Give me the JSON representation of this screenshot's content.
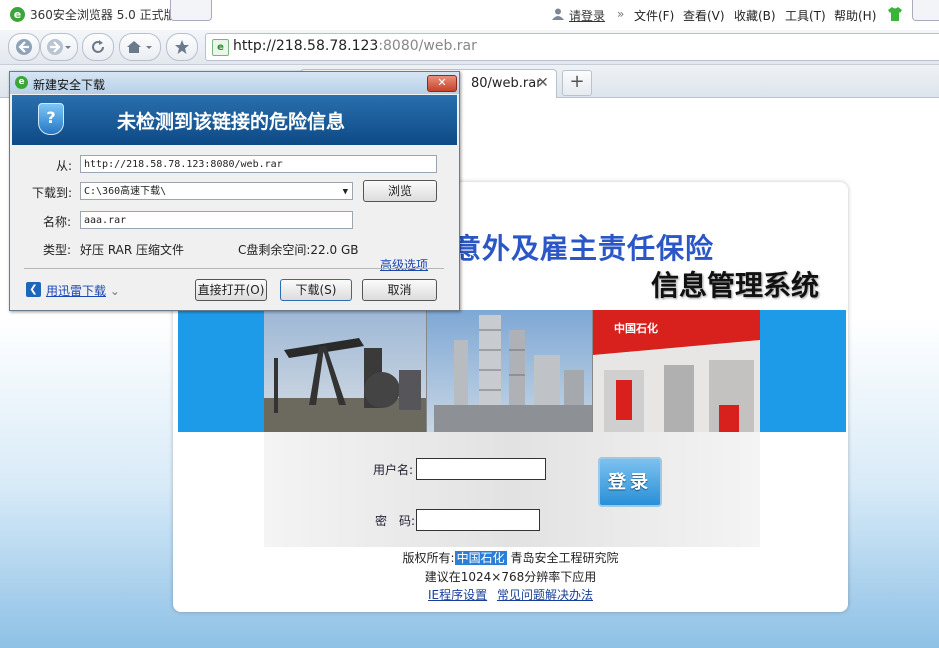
{
  "browser": {
    "title": "360安全浏览器 5.0 正式版",
    "login": "请登录",
    "menu": [
      "文件(F)",
      "查看(V)",
      "收藏(B)",
      "工具(T)",
      "帮助(H)"
    ],
    "url_host": "http://218.58.78.123",
    "url_rest": ":8080/web.rar",
    "tab_label": "80/web.rar"
  },
  "dialog": {
    "title": "新建安全下载",
    "banner": "未检测到该链接的危险信息",
    "from_label": "从:",
    "from_value": "http://218.58.78.123:8080/web.rar",
    "saveto_label": "下载到:",
    "saveto_value": "C:\\360高速下载\\",
    "browse_button": "浏览",
    "name_label": "名称:",
    "name_value": "aaa.rar",
    "type_label": "类型:",
    "type_value": "好压 RAR 压缩文件",
    "disk_space": "C盘剩余空间:22.0 GB",
    "advanced_link": "高级选项",
    "xunlei_link": "用迅雷下载",
    "open_button": "直接打开(O)",
    "download_button": "下载(S)",
    "cancel_button": "取消"
  },
  "site": {
    "title_line1": "意外及雇主责任保险",
    "title_line2": "信息管理系统",
    "username_label": "用户名:",
    "password_label": "密　码:",
    "login_button": "登录",
    "copyright_prefix": "版权所有:",
    "copyright_org": "中国石化",
    "copyright_suffix": "青岛安全工程研究院",
    "resolution_note": "建议在1024×768分辨率下应用",
    "link_ie": "IE程序设置",
    "link_faq": "常见问题解决办法",
    "photo_sign": "中国石化"
  }
}
